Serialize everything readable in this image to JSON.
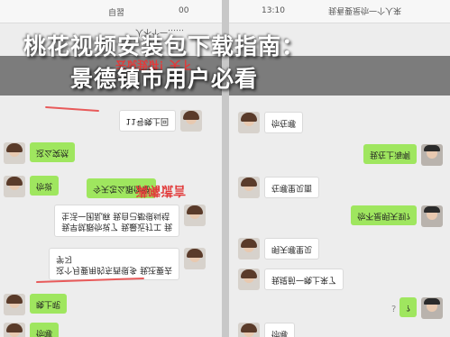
{
  "title": {
    "line1": "桃花视频安装包下载指南：",
    "line2": "景德镇市用户必看"
  },
  "left_phone": {
    "header_left": "00",
    "header_right": "自習",
    "top_text": "人不个一……",
    "red_top": "去说我讲！天下",
    "red_note": "满嘴谎言",
    "messages": [
      {
        "side": "right",
        "avatar": "girl",
        "text": "11号晚上回"
      },
      {
        "side": "left",
        "avatar": "girl",
        "text": "这么突然"
      },
      {
        "side": "left",
        "avatar": "girl",
        "text": "你说"
      },
      {
        "side": "left",
        "avatar": "girl",
        "text": "今天怎么跟你说"
      },
      {
        "side": "right",
        "avatar": "girl",
        "text": "我早就跟你说了 我最近打工 我\n生活一团乱麻 我自己都很纠结"
      },
      {
        "side": "right",
        "avatar": "girl",
        "text": "这个月要用的东西很多 我还要去\n学习"
      },
      {
        "side": "left",
        "avatar": "girl",
        "text": "晚上呢"
      },
      {
        "side": "left",
        "avatar": "girl",
        "text": "你哪"
      }
    ]
  },
  "right_phone": {
    "header_time": "13:10",
    "top_text": "我看要是你一个人来",
    "question_mark": "?",
    "messages": [
      {
        "side": "left",
        "avatar": "girl",
        "text": "你在哪"
      },
      {
        "side": "right",
        "avatar": "boy",
        "text": "我在上海啊"
      },
      {
        "side": "left",
        "avatar": "girl",
        "text": "在哪里见面"
      },
      {
        "side": "right",
        "avatar": "boy",
        "text": "你不是明天到?"
      },
      {
        "side": "left",
        "avatar": "girl",
        "text": "明天哪里见"
      },
      {
        "side": "left",
        "avatar": "girl",
        "text": "我提前一晚上来了"
      },
      {
        "side": "right",
        "avatar": "boy",
        "text": "?"
      },
      {
        "side": "left",
        "avatar": "girl",
        "text": "你哪"
      }
    ]
  }
}
